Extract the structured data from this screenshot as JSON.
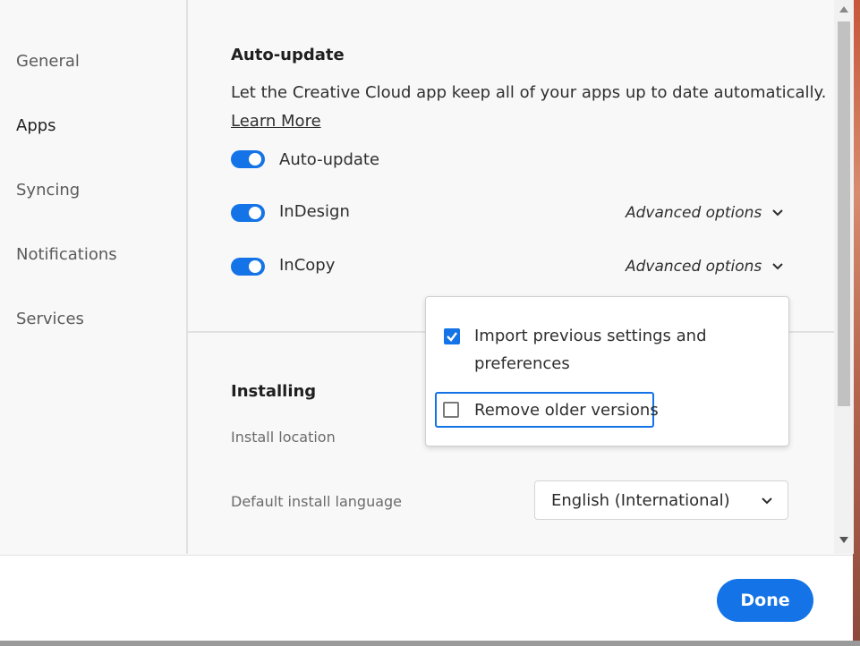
{
  "sidebar": {
    "items": [
      {
        "label": "General"
      },
      {
        "label": "Apps"
      },
      {
        "label": "Syncing"
      },
      {
        "label": "Notifications"
      },
      {
        "label": "Services"
      }
    ],
    "active": "Apps"
  },
  "auto_update": {
    "title": "Auto-update",
    "description": "Let the Creative Cloud app keep all of your apps up to date automatically.",
    "learn_more": "Learn More",
    "toggles": [
      {
        "label": "Auto-update",
        "on": true
      },
      {
        "label": "InDesign",
        "on": true,
        "advanced": "Advanced options"
      },
      {
        "label": "InCopy",
        "on": true,
        "advanced": "Advanced options"
      }
    ]
  },
  "popover": {
    "options": [
      {
        "label_line1": "Import previous settings and",
        "label_line2": "preferences",
        "checked": true
      },
      {
        "label": "Remove older versions",
        "checked": false
      }
    ]
  },
  "installing": {
    "title": "Installing",
    "install_location": "Install location",
    "default_language_label": "Default install language",
    "default_language_value": "English (International)"
  },
  "footer": {
    "done_label": "Done"
  },
  "colors": {
    "accent": "#1473e6"
  }
}
